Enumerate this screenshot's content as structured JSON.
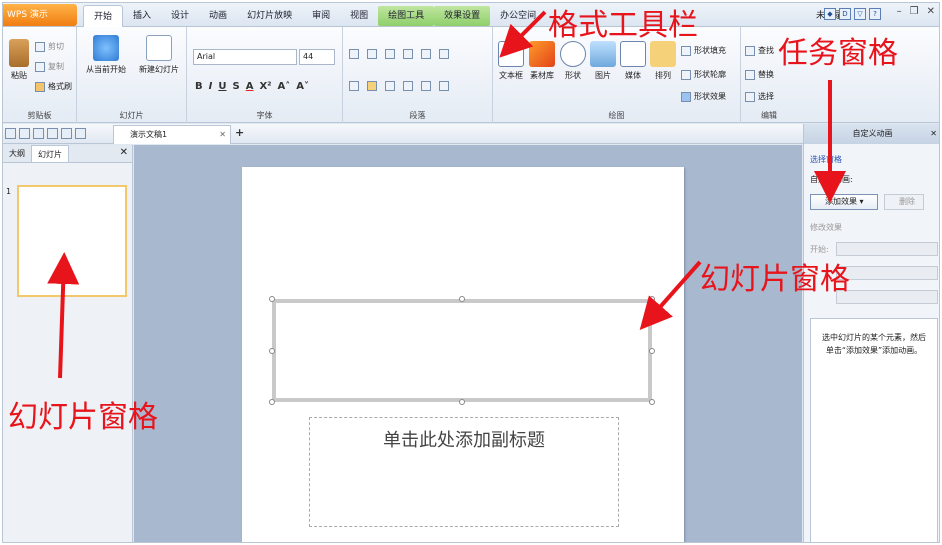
{
  "app": {
    "title": "WPS 演示"
  },
  "menu_tabs": [
    "开始",
    "插入",
    "设计",
    "动画",
    "幻灯片放映",
    "审阅",
    "视图",
    "绘图工具",
    "效果设置",
    "办公空间"
  ],
  "login_label": "未登录",
  "ribbon": {
    "clipboard": {
      "paste": "粘贴",
      "cut": "剪切",
      "copy": "复制",
      "format_painter": "格式刷",
      "label": "剪贴板"
    },
    "slides": {
      "from_current": "从当前开始",
      "new_slide": "新建幻灯片",
      "label": "幻灯片"
    },
    "font": {
      "name": "Arial",
      "size": "44",
      "label": "字体"
    },
    "paragraph": {
      "label": "段落"
    },
    "drawing": {
      "textbox": "文本框",
      "materials": "素材库",
      "shape": "形状",
      "picture": "图片",
      "media": "媒体",
      "arrange": "排列",
      "shape_fill": "形状填充",
      "shape_outline": "形状轮廓",
      "shape_effect": "形状效果",
      "label": "绘图"
    },
    "edit": {
      "find": "查找",
      "replace": "替换",
      "select": "选择",
      "label": "编辑"
    }
  },
  "document_tab": "演示文稿1",
  "left_pane": {
    "tabs": [
      "大纲",
      "幻灯片"
    ],
    "slide_number": "1"
  },
  "slide": {
    "subtitle_placeholder": "单击此处添加副标题"
  },
  "task_pane": {
    "title": "自定义动画",
    "select_pane": "选择窗格",
    "custom_animation": "自定义动画:",
    "add_effect": "添加效果",
    "delete": "删除",
    "modify_effect": "修改效果",
    "start": "开始:",
    "hint": "选中幻灯片的某个元素，然后单击“添加效果”添加动画。"
  },
  "annotations": {
    "format_toolbar": "格式工具栏",
    "task_pane": "任务窗格",
    "slide_pane_right": "幻灯片窗格",
    "slide_pane_left": "幻灯片窗格"
  }
}
